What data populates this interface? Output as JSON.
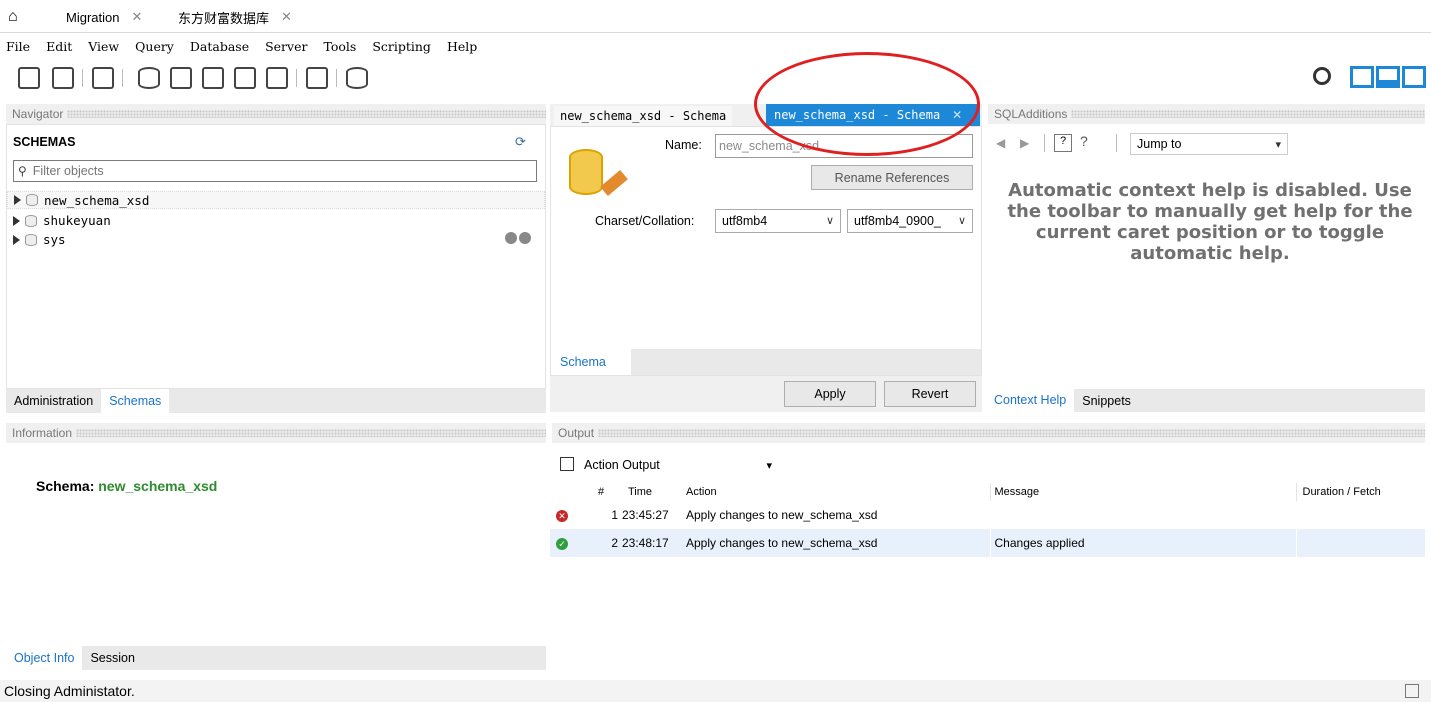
{
  "tabs": {
    "home": "home-icon",
    "tab1": "Migration",
    "tab2": "东方财富数据库"
  },
  "menu": [
    "File",
    "Edit",
    "View",
    "Query",
    "Database",
    "Server",
    "Tools",
    "Scripting",
    "Help"
  ],
  "navigator": {
    "header": "Navigator",
    "schemas_title": "SCHEMAS",
    "filter_placeholder": "Filter objects",
    "items": [
      {
        "label": "new_schema_xsd"
      },
      {
        "label": "shukeyuan"
      },
      {
        "label": "sys"
      }
    ],
    "tabs": [
      "Administration",
      "Schemas"
    ]
  },
  "information": {
    "header": "Information",
    "schema_label": "Schema:",
    "schema_value": "new_schema_xsd",
    "tabs": [
      "Object Info",
      "Session"
    ]
  },
  "editor": {
    "tab1": "new_schema_xsd - Schema",
    "tab2": "new_schema_xsd - Schema",
    "name_label": "Name:",
    "name_value": "new_schema_xsd",
    "rename_button": "Rename References",
    "charset_label": "Charset/Collation:",
    "charset_value": "utf8mb4",
    "collation_value": "utf8mb4_0900_",
    "bottom_tab": "Schema",
    "apply": "Apply",
    "revert": "Revert"
  },
  "sqladditions": {
    "header": "SQLAdditions",
    "jump_to": "Jump to",
    "help_text": "Automatic context help is disabled. Use the toolbar to manually get help for the current caret position or to toggle automatic help.",
    "tabs": [
      "Context Help",
      "Snippets"
    ]
  },
  "output": {
    "header": "Output",
    "selector": "Action Output",
    "columns": [
      "#",
      "Time",
      "Action",
      "Message",
      "Duration / Fetch"
    ],
    "rows": [
      {
        "num": "1",
        "time": "23:45:27",
        "action": "Apply changes to new_schema_xsd",
        "message": "",
        "duration": "",
        "status": "error"
      },
      {
        "num": "2",
        "time": "23:48:17",
        "action": "Apply changes to new_schema_xsd",
        "message": "Changes applied",
        "duration": "",
        "status": "success"
      }
    ]
  },
  "status": "Closing Administator.",
  "colors": {
    "accent": "#1a73c9",
    "tab_active": "#1e88d8",
    "schema_green": "#2e8b2e",
    "annotation_red": "#e02020"
  }
}
